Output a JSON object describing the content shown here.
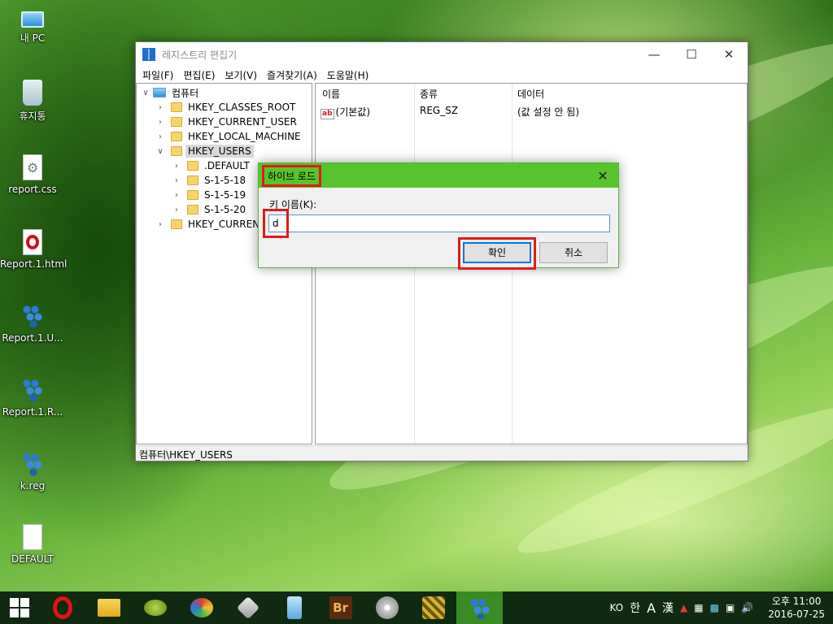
{
  "desktop": {
    "icons": [
      {
        "label": "내 PC",
        "icon": "pc-icon"
      },
      {
        "label": "휴지통",
        "icon": "recycle-bin-icon"
      },
      {
        "label": "report.css",
        "icon": "css-file-icon"
      },
      {
        "label": "Report.1.html",
        "icon": "opera-html-icon"
      },
      {
        "label": "Report.1.U...",
        "icon": "registry-file-icon"
      },
      {
        "label": "Report.1.R...",
        "icon": "registry-file-icon"
      },
      {
        "label": "k.reg",
        "icon": "registry-file-icon"
      },
      {
        "label": "DEFAULT",
        "icon": "blank-file-icon"
      }
    ]
  },
  "regedit": {
    "title": "레지스트리 편집기",
    "menu": [
      "파일(F)",
      "편집(E)",
      "보기(V)",
      "즐겨찾기(A)",
      "도움말(H)"
    ],
    "tree": {
      "root": "컴퓨터",
      "hkcr": "HKEY_CLASSES_ROOT",
      "hkcu": "HKEY_CURRENT_USER",
      "hklm": "HKEY_LOCAL_MACHINE",
      "hku": "HKEY_USERS",
      "hku_children": [
        ".DEFAULT",
        "S-1-5-18",
        "S-1-5-19",
        "S-1-5-20"
      ],
      "hkcc": "HKEY_CURRENT_"
    },
    "columns": {
      "name": "이름",
      "type": "종류",
      "data": "데이터"
    },
    "values": [
      {
        "name": "(기본값)",
        "type": "REG_SZ",
        "data": "(값 설정 안 됨)",
        "icon": "ab"
      }
    ],
    "status": "컴퓨터\\HKEY_USERS"
  },
  "dialog": {
    "title": "하이브 로드",
    "label": "키 이름(K):",
    "input_value": "d",
    "ok": "확인",
    "cancel": "취소"
  },
  "taskbar": {
    "apps": [
      "opera-icon",
      "file-explorer-icon",
      "olive-app-icon",
      "disk-app-icon",
      "tools-app-icon",
      "phone-app-icon",
      "bridge-icon",
      "installer-icon",
      "archive-app-icon",
      "regedit-icon"
    ],
    "bridge_label": "Br",
    "tray": {
      "lang": "KO",
      "ime": "한",
      "mode": "A",
      "hanja": "漢"
    },
    "clock": {
      "period_time": "오후 11:00",
      "date": "2016-07-25"
    }
  },
  "colors": {
    "dialog_title": "#58c42c",
    "highlight": "#e01b1b",
    "accent": "#0078d7"
  }
}
